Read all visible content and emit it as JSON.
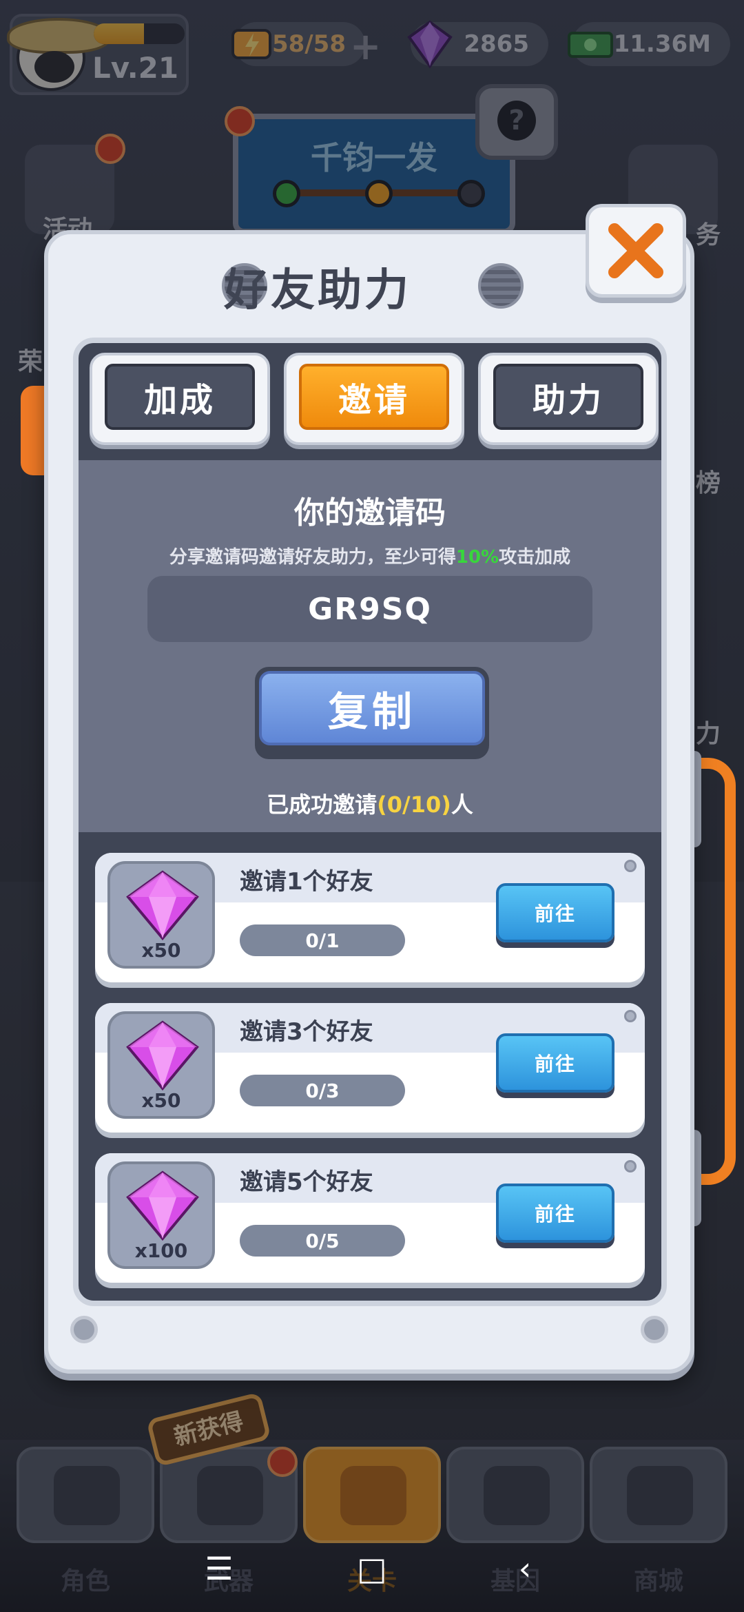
{
  "hud": {
    "level": "Lv.21",
    "xp_fraction": 0.55,
    "energy": "58/58",
    "gems": "2865",
    "cash": "11.36M"
  },
  "background": {
    "quest_title": "千钧一发",
    "left_icons": [
      {
        "label": "活动"
      },
      {
        "label": "荣"
      }
    ],
    "right_icons": [
      {
        "label": "务"
      },
      {
        "label": "榜"
      },
      {
        "label": "力"
      }
    ]
  },
  "dialog": {
    "title": "好友助力",
    "tabs": [
      {
        "label": "加成",
        "active": false
      },
      {
        "label": "邀请",
        "active": true
      },
      {
        "label": "助力",
        "active": false
      }
    ],
    "invite_title": "你的邀请码",
    "invite_desc_prefix": "分享邀请码邀请好友助力，至少可得",
    "invite_desc_percent": "10%",
    "invite_desc_suffix": "攻击加成",
    "invite_code": "GR9SQ",
    "copy_label": "复制",
    "invited_prefix": "已成功邀请",
    "invited_count": "(0/10)",
    "invited_suffix": "人",
    "rewards": [
      {
        "title": "邀请1个好友",
        "qty": "x50",
        "progress": "0/1",
        "button": "前往"
      },
      {
        "title": "邀请3个好友",
        "qty": "x50",
        "progress": "0/3",
        "button": "前往"
      },
      {
        "title": "邀请5个好友",
        "qty": "x100",
        "progress": "0/5",
        "button": "前往"
      }
    ]
  },
  "bottom_nav": {
    "new_badge": "新获得",
    "items": [
      {
        "label": "角色",
        "active": false
      },
      {
        "label": "武器",
        "active": false
      },
      {
        "label": "关卡",
        "active": true
      },
      {
        "label": "基因",
        "active": false
      },
      {
        "label": "商城",
        "active": false
      }
    ]
  },
  "colors": {
    "accent_orange": "#ef8a0c",
    "copy_blue": "#5f86d6",
    "go_blue": "#2d93dc",
    "percent_green": "#38d63c",
    "count_yellow": "#f7d341"
  }
}
